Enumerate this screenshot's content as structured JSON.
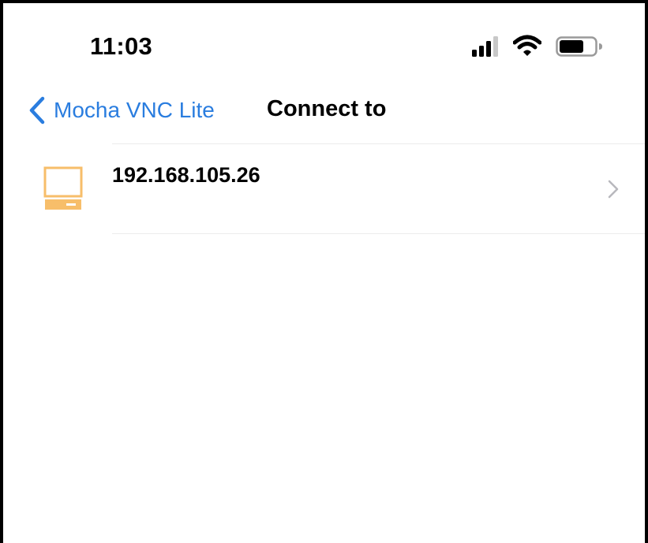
{
  "status_bar": {
    "time": "11:03",
    "icons": [
      "signal-icon",
      "wifi-icon",
      "battery-icon"
    ]
  },
  "nav": {
    "back_label": "Mocha VNC Lite",
    "title": "Connect to",
    "accent_color": "#2a7ddf"
  },
  "hosts": [
    {
      "address": "192.168.105.26",
      "icon": "computer-icon",
      "icon_color": "#f7be6a"
    }
  ]
}
